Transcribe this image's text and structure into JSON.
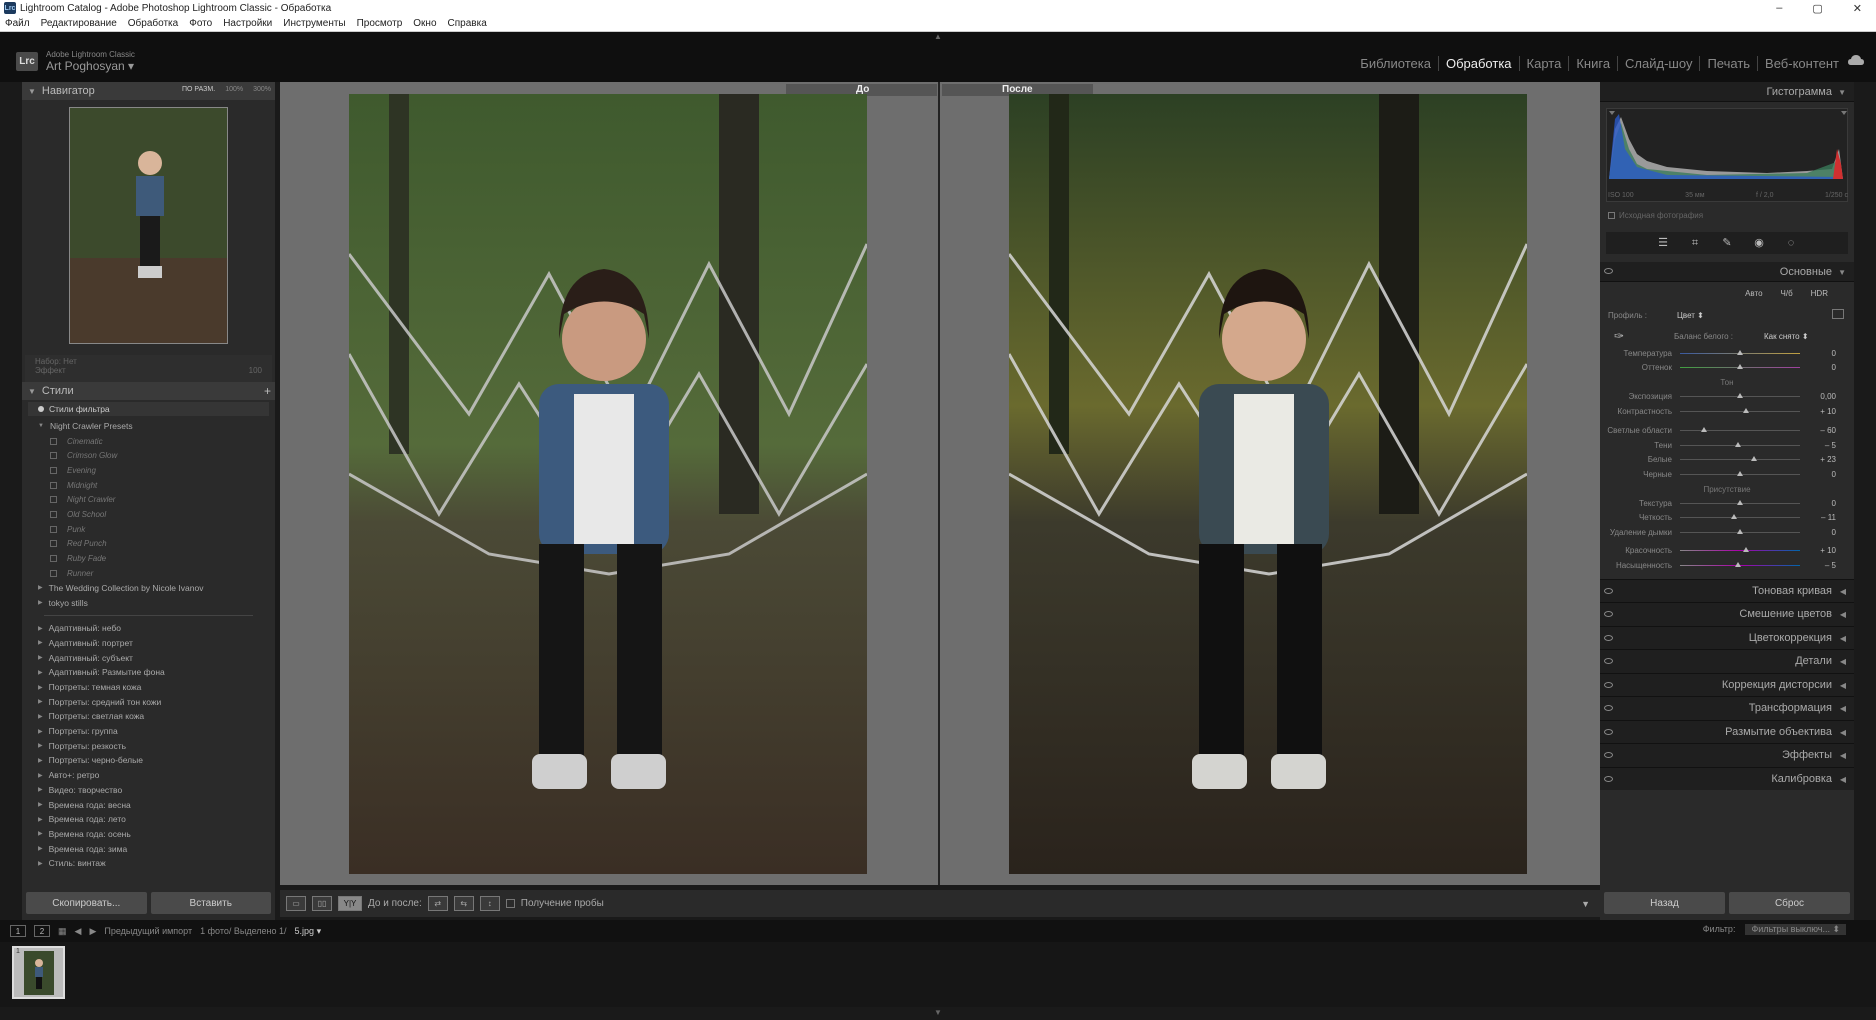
{
  "window": {
    "title": "Lightroom Catalog - Adobe Photoshop Lightroom Classic - Обработка",
    "app_icon": "Lrc"
  },
  "menu": [
    "Файл",
    "Редактирование",
    "Обработка",
    "Фото",
    "Настройки",
    "Инструменты",
    "Просмотр",
    "Окно",
    "Справка"
  ],
  "identity": {
    "small": "Adobe Lightroom Classic",
    "name": "Art Poghosyan",
    "logo": "Lrc"
  },
  "modules": [
    "Библиотека",
    "Обработка",
    "Карта",
    "Книга",
    "Слайд-шоу",
    "Печать",
    "Веб-контент"
  ],
  "active_module": "Обработка",
  "navigator": {
    "title": "Навигатор",
    "zoom_opts": [
      "ПО РАЗМ.",
      "100%",
      "300%"
    ],
    "preset_label": "Набор:",
    "preset_val": "Нет",
    "effect_label": "Эффект",
    "effect_val": "100"
  },
  "presets": {
    "title": "Стили",
    "filter": "Стили фильтра",
    "group1": "Night Crawler Presets",
    "group1_items": [
      "Cinematic",
      "Crimson Glow",
      "Evening",
      "Midnight",
      "Night Crawler",
      "Old School",
      "Punk",
      "Red Punch",
      "Ruby Fade",
      "Runner"
    ],
    "groups2": [
      "The Wedding Collection by Nicole Ivanov",
      "tokyo stills"
    ],
    "groups3": [
      "Адаптивный: небо",
      "Адаптивный: портрет",
      "Адаптивный: субъект",
      "Адаптивный: Размытие фона",
      "Портреты: темная кожа",
      "Портреты: средний тон кожи",
      "Портреты: светлая кожа",
      "Портреты: группа",
      "Портреты: резкость",
      "Портреты: черно-белые",
      "Авто+: ретро",
      "Видео: творчество",
      "Времена года: весна",
      "Времена года: лето",
      "Времена года: осень",
      "Времена года: зима",
      "Стиль: винтаж"
    ]
  },
  "left_buttons": {
    "copy": "Скопировать...",
    "paste": "Вставить"
  },
  "view": {
    "before": "До",
    "after": "После"
  },
  "toolbar": {
    "before_after_label": "До и после:",
    "proof_label": "Получение пробы",
    "yy": "Y|Y"
  },
  "right": {
    "histogram_title": "Гистограмма",
    "hist_meta": [
      "ISO 100",
      "35 мм",
      "f / 2,0",
      "1/250 с"
    ],
    "original_photo": "Исходная фотография",
    "basic_title": "Основные",
    "auto_buttons": [
      "Авто",
      "Ч/б",
      "HDR"
    ],
    "profile_label": "Профиль :",
    "profile_val": "Цвет",
    "wb_label": "Баланс белого :",
    "wb_val": "Как снято",
    "wb_sliders": [
      {
        "name": "Температура",
        "val": "0"
      },
      {
        "name": "Оттенок",
        "val": "0"
      }
    ],
    "tone_title": "Тон",
    "tone_sliders1": [
      {
        "name": "Экспозиция",
        "val": "0,00"
      },
      {
        "name": "Контрастность",
        "val": "+ 10"
      }
    ],
    "tone_sliders2": [
      {
        "name": "Светлые области",
        "val": "– 60"
      },
      {
        "name": "Тени",
        "val": "– 5"
      },
      {
        "name": "Белые",
        "val": "+ 23"
      },
      {
        "name": "Черные",
        "val": "0"
      }
    ],
    "presence_title": "Присутствие",
    "presence_sliders1": [
      {
        "name": "Текстура",
        "val": "0"
      },
      {
        "name": "Четкость",
        "val": "– 11"
      },
      {
        "name": "Удаление дымки",
        "val": "0"
      }
    ],
    "presence_sliders2": [
      {
        "name": "Красочность",
        "val": "+ 10"
      },
      {
        "name": "Насыщенность",
        "val": "– 5"
      }
    ],
    "collapsed": [
      "Тоновая кривая",
      "Смешение цветов",
      "Цветокоррекция",
      "Детали",
      "Коррекция дисторсии",
      "Трансформация",
      "Размытие объектива",
      "Эффекты",
      "Калибровка"
    ],
    "buttons": {
      "back": "Назад",
      "reset": "Сброс"
    }
  },
  "filmstrip": {
    "source": "Предыдущий импорт",
    "count": "1 фото/ Выделено 1/",
    "file": "5.jpg",
    "filter_label": "Фильтр:",
    "filter_val": "Фильтры выключ...",
    "page1": "1",
    "page2": "2",
    "thumb_num": "1"
  }
}
